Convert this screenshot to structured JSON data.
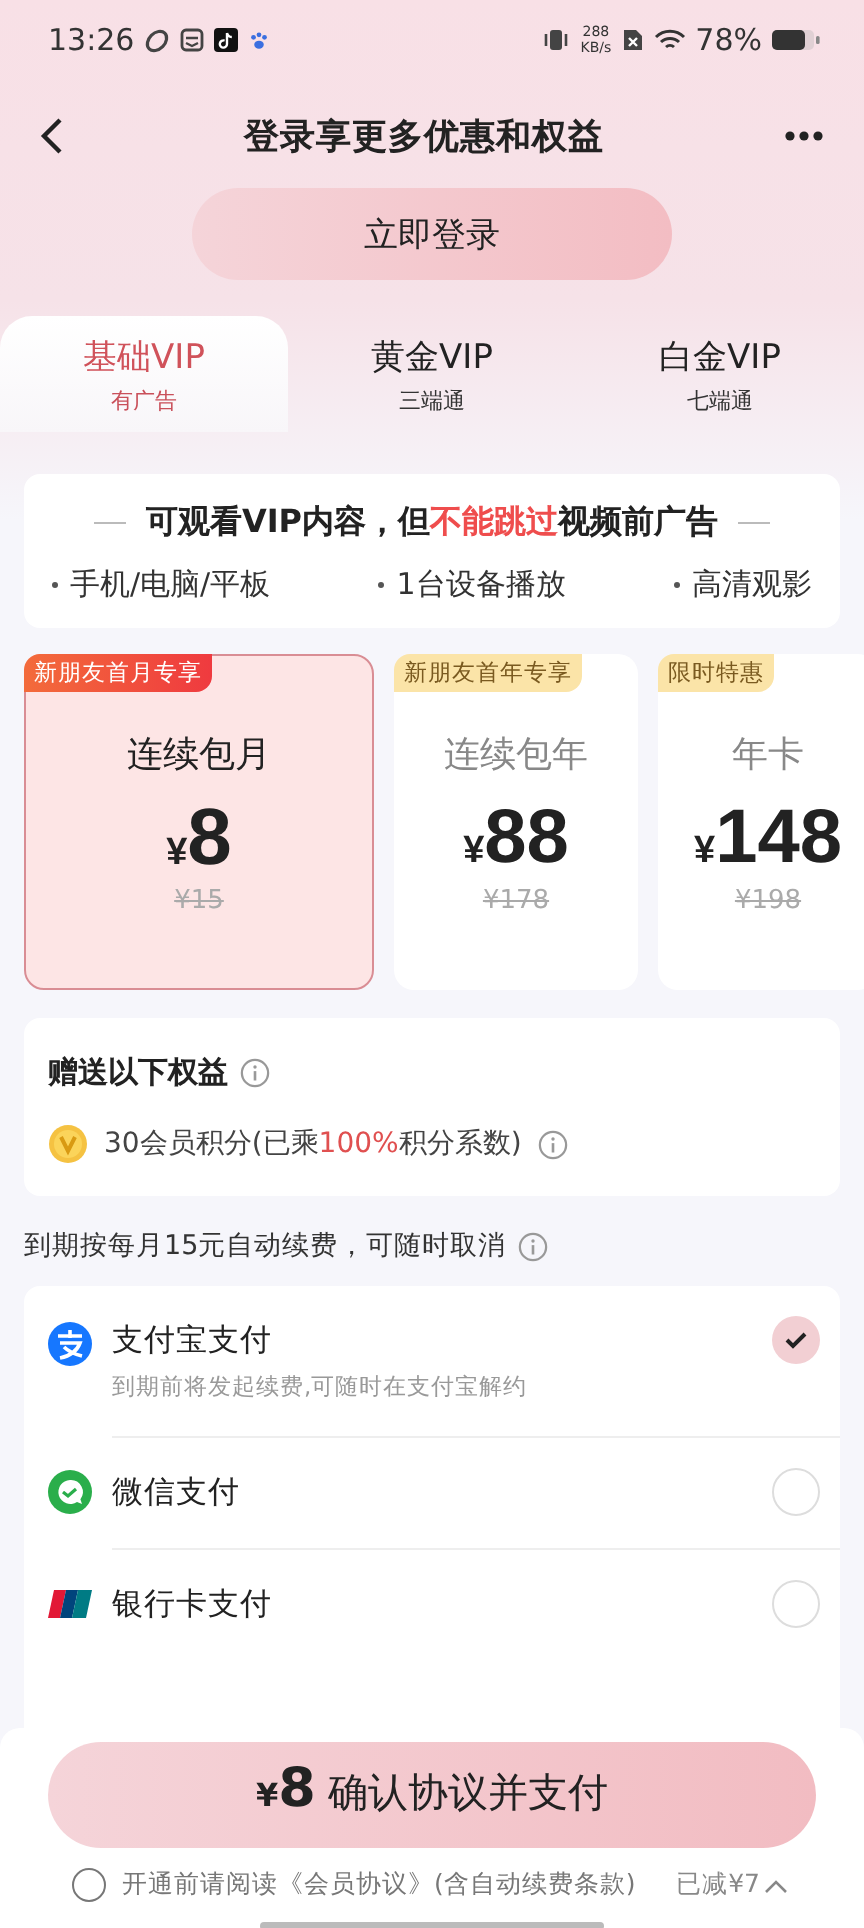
{
  "status_bar": {
    "time": "13:26",
    "net_speed": "288",
    "net_unit": "KB/s",
    "battery": "78%"
  },
  "header": {
    "title": "登录享更多优惠和权益",
    "login_button": "立即登录"
  },
  "tabs": [
    {
      "label": "基础VIP",
      "sublabel": "有广告",
      "selected": true
    },
    {
      "label": "黄金VIP",
      "sublabel": "三端通",
      "selected": false
    },
    {
      "label": "白金VIP",
      "sublabel": "七端通",
      "selected": false
    }
  ],
  "info": {
    "headline": [
      {
        "text": "可观看VIP内容，但",
        "highlight": false
      },
      {
        "text": "不能跳过",
        "highlight": true
      },
      {
        "text": "视频前广告",
        "highlight": false
      }
    ],
    "features": [
      "手机/电脑/平板",
      "1台设备播放",
      "高清观影"
    ]
  },
  "plans": [
    {
      "badge": "新朋友首月专享",
      "name": "连续包月",
      "currency": "¥",
      "price": "8",
      "original_price": "¥15",
      "selected": true
    },
    {
      "badge": "新朋友首年专享",
      "name": "连续包年",
      "currency": "¥",
      "price": "88",
      "original_price": "¥178",
      "selected": false
    },
    {
      "badge": "限时特惠",
      "name": "年卡",
      "currency": "¥",
      "price": "148",
      "original_price": "¥198",
      "selected": false
    }
  ],
  "benefits": {
    "title": "赠送以下权益",
    "items": [
      {
        "parts": [
          {
            "text": "30会员积分(已乘",
            "highlight": false
          },
          {
            "text": "100%",
            "highlight": true
          },
          {
            "text": "积分系数)",
            "highlight": false
          }
        ]
      }
    ]
  },
  "renewal_note": "到期按每月15元自动续费，可随时取消",
  "payments": [
    {
      "kind": "alipay",
      "name": "支付宝支付",
      "note": "到期前将发起续费,可随时在支付宝解约",
      "selected": true
    },
    {
      "kind": "wechat",
      "name": "微信支付",
      "selected": false
    },
    {
      "kind": "unionpay",
      "name": "银行卡支付",
      "selected": false
    }
  ],
  "footer": {
    "currency": "¥",
    "price": "8",
    "action": "确认协议并支付",
    "agreement": "开通前请阅读《会员协议》(含自动续费条款)",
    "agreed": false,
    "discount": "已减¥7"
  }
}
